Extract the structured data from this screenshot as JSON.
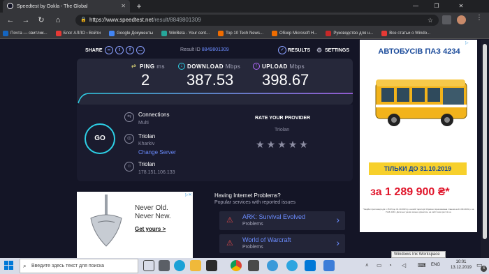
{
  "browser": {
    "tab_title": "Speedtest by Ookla - The Global",
    "url_host": "https://www.speedtest.net",
    "url_path": "/result/8849801309",
    "bookmarks": [
      {
        "label": "Почта — свитлик...",
        "color": "#1565c0"
      },
      {
        "label": "Блог АЛЛО › Войти",
        "color": "#e53935"
      },
      {
        "label": "Google Документы",
        "color": "#4285f4"
      },
      {
        "label": "WinBeta - Your cent...",
        "color": "#26a69a"
      },
      {
        "label": "Top 10 Tech News...",
        "color": "#ef6c00"
      },
      {
        "label": "Обзор Microsoft H...",
        "color": "#ef6c00"
      },
      {
        "label": "Руководство для н...",
        "color": "#c62828"
      },
      {
        "label": "Все статьи о Windo...",
        "color": "#e53935"
      }
    ]
  },
  "speedtest": {
    "share_label": "SHARE",
    "result_label": "Result ID",
    "result_id": "8849801309",
    "results_label": "RESULTS",
    "settings_label": "SETTINGS",
    "ping_label": "PING",
    "ping_unit": "ms",
    "ping_value": "2",
    "download_label": "DOWNLOAD",
    "download_unit": "Mbps",
    "download_value": "387.53",
    "upload_label": "UPLOAD",
    "upload_unit": "Mbps",
    "upload_value": "398.67",
    "go_label": "GO",
    "connections_label": "Connections",
    "connections_value": "Multi",
    "server_name": "Triolan",
    "server_city": "Kharkiv",
    "change_server": "Change Server",
    "isp_name": "Triolan",
    "isp_ip": "178.151.106.133",
    "rate_label": "RATE YOUR PROVIDER",
    "rate_provider": "Triolan",
    "stars_filled": 0
  },
  "ad_right": {
    "title": "АВТОБУСІВ ПАЗ 4234",
    "badge": "ТІЛЬКИ ДО 31.10.2019",
    "price": "за 1 289 900 ₴*",
    "fine_print": "*Акційні пропозиція діє з 15.09 до 31.10.2019 р. на всій території України. Ціна вказана станом на 13.09.2019 р. на ПАЗ-4234. Детальні умови можна дізнатись на сайті www.paz.ck.ua"
  },
  "ad_bottom": {
    "line1": "Never Old.",
    "line2": "Never New.",
    "cta": "Get yours >"
  },
  "problems": {
    "title": "Having Internet Problems?",
    "subtitle": "Popular services with reported issues",
    "items": [
      {
        "name": "ARK: Survival Evolved",
        "status": "Problems"
      },
      {
        "name": "World of Warcraft",
        "status": "Problems"
      }
    ]
  },
  "tooltip": "Windows Ink Workspace",
  "taskbar": {
    "search_placeholder": "Введите здесь текст для поиска",
    "lang": "ENG",
    "time": "10:01",
    "date": "13.12.2019",
    "badge_count": "4"
  }
}
